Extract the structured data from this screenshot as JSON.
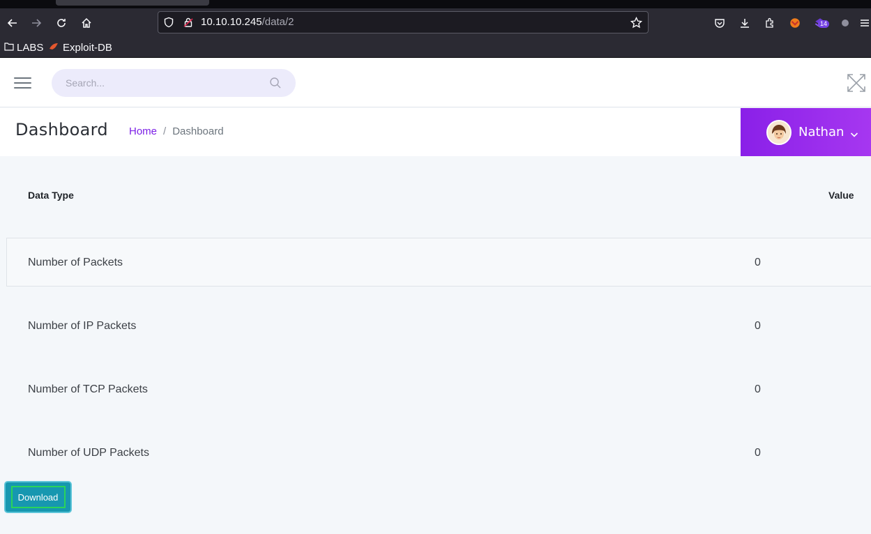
{
  "browser": {
    "url_host": "10.10.10.245",
    "url_path": "/data/2",
    "extension_badge": "14",
    "bookmarks": [
      {
        "label": "LABS",
        "icon": "folder-icon"
      },
      {
        "label": "Exploit-DB",
        "icon": "exploit-db-icon"
      }
    ]
  },
  "topbar": {
    "search_placeholder": "Search..."
  },
  "header": {
    "title": "Dashboard",
    "breadcrumb": {
      "home": "Home",
      "separator": "/",
      "current": "Dashboard"
    },
    "user": {
      "name": "Nathan"
    }
  },
  "table": {
    "columns": {
      "type": "Data Type",
      "value": "Value"
    },
    "rows": [
      {
        "label": "Number of Packets",
        "value": "0"
      },
      {
        "label": "Number of IP Packets",
        "value": "0"
      },
      {
        "label": "Number of TCP Packets",
        "value": "0"
      },
      {
        "label": "Number of UDP Packets",
        "value": "0"
      }
    ]
  },
  "actions": {
    "download_label": "Download"
  },
  "colors": {
    "accent": "#7b1fe6",
    "user_menu": "#9a2cec",
    "download": "#1797b0"
  }
}
